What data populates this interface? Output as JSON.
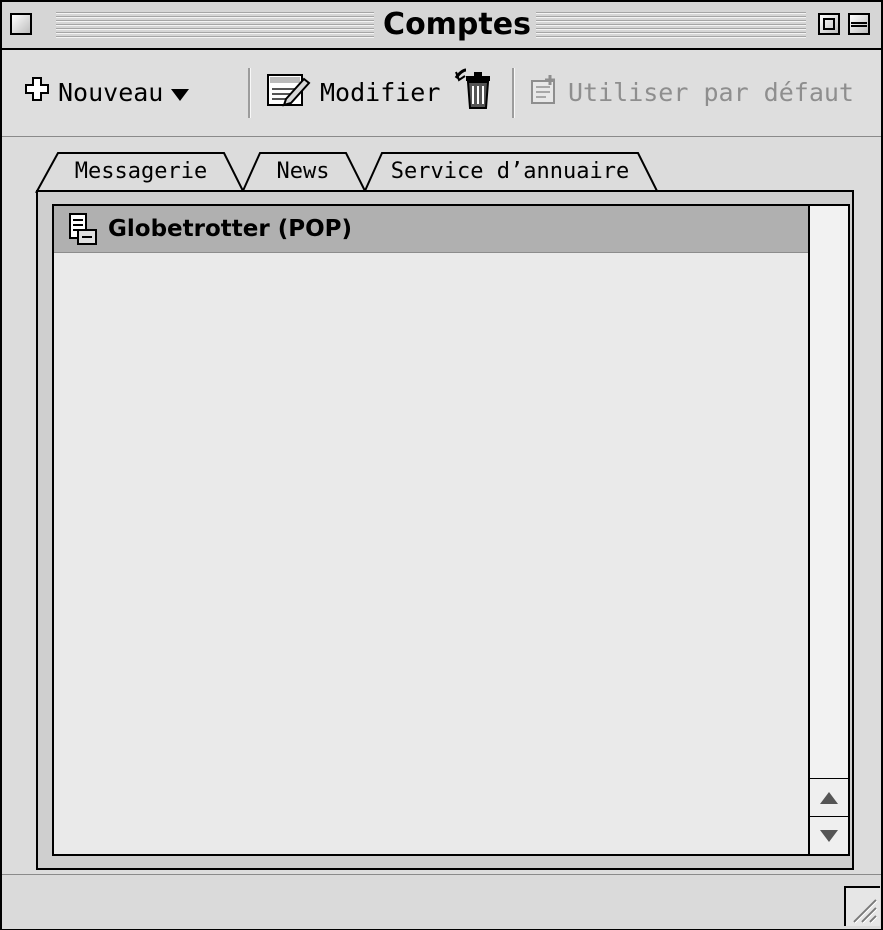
{
  "window": {
    "title": "Comptes"
  },
  "toolbar": {
    "new_label": "Nouveau",
    "edit_label": "Modifier",
    "default_label": "Utiliser par défaut"
  },
  "tabs": [
    {
      "label": "Messagerie",
      "selected": true
    },
    {
      "label": "News",
      "selected": false
    },
    {
      "label": "Service d’annuaire",
      "selected": false
    }
  ],
  "accounts": [
    {
      "name": "Globetrotter (POP)",
      "icon": "pop-server-icon"
    }
  ]
}
